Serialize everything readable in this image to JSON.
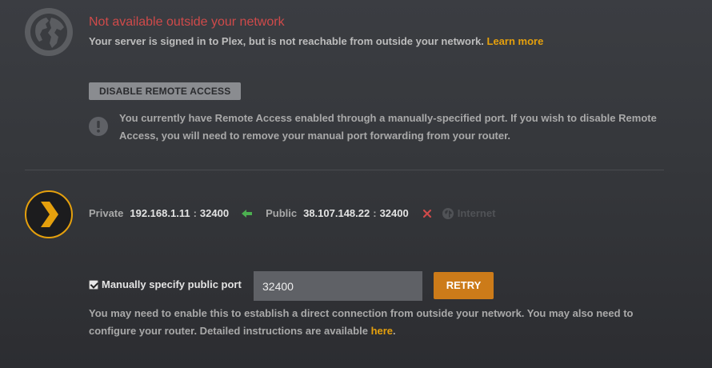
{
  "status": {
    "title": "Not available outside your network",
    "description": "Your server is signed in to Plex, but is not reachable from outside your network.",
    "learn_more": "Learn more",
    "icon": "globe-icon"
  },
  "disable_button": "DISABLE REMOTE ACCESS",
  "warning": {
    "icon": "exclamation-icon",
    "text": "You currently have Remote Access enabled through a manually-specified port. If you wish to disable Remote Access, you will need to remove your manual port forwarding from your router."
  },
  "connection": {
    "private_label": "Private",
    "private_ip": "192.168.1.11",
    "private_sep": ":",
    "private_port": "32400",
    "arrow_icon": "left-arrow-icon",
    "arrow_color": "#4caf50",
    "public_label": "Public",
    "public_ip": "38.107.148.22",
    "public_sep": ":",
    "public_port": "32400",
    "x_icon": "x-icon",
    "x_color": "#cf4a4a",
    "internet_icon": "globe-icon",
    "internet_label": "Internet"
  },
  "port_form": {
    "checkbox_checked": true,
    "checkbox_label": "Manually specify public port",
    "port_value": "32400",
    "retry": "RETRY"
  },
  "help": {
    "text": "You may need to enable this to establish a direct connection from outside your network. You may also need to configure your router. Detailed instructions are available",
    "link": "here",
    "end": "."
  },
  "colors": {
    "accent": "#e5a00d",
    "error": "#cf4a4a",
    "button_orange": "#cc7b19"
  }
}
